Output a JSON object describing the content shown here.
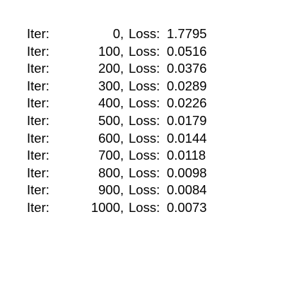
{
  "log": {
    "iter_label": "Iter:",
    "loss_label": "Loss:",
    "lines": [
      {
        "iter": "0",
        "loss": "1.7795"
      },
      {
        "iter": "100",
        "loss": "0.0516"
      },
      {
        "iter": "200",
        "loss": "0.0376"
      },
      {
        "iter": "300",
        "loss": "0.0289"
      },
      {
        "iter": "400",
        "loss": "0.0226"
      },
      {
        "iter": "500",
        "loss": "0.0179"
      },
      {
        "iter": "600",
        "loss": "0.0144"
      },
      {
        "iter": "700",
        "loss": "0.0118"
      },
      {
        "iter": "800",
        "loss": "0.0098"
      },
      {
        "iter": "900",
        "loss": "0.0084"
      },
      {
        "iter": "1000",
        "loss": "0.0073"
      }
    ]
  }
}
